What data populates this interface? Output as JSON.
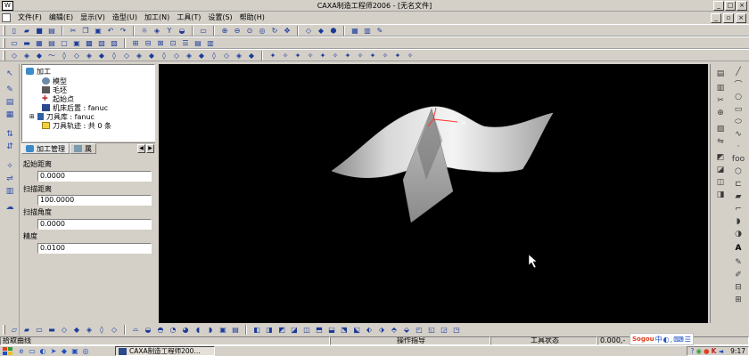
{
  "window": {
    "title": "CAXA制造工程师2006 - [无名文件]"
  },
  "menubar": {
    "items": [
      "文件(F)",
      "编辑(E)",
      "显示(V)",
      "造型(U)",
      "加工(N)",
      "工具(T)",
      "设置(S)",
      "帮助(H)"
    ]
  },
  "tree": {
    "root": "加工",
    "items": [
      "模型",
      "毛坯",
      "起始点",
      "机床后置 : fanuc",
      "刀具库 : fanuc",
      "刀具轨迹 : 共 0 条"
    ]
  },
  "panel_tabs": {
    "tab1": "加工管理",
    "tab2": "属"
  },
  "params": {
    "start_dist_label": "起始距离",
    "start_dist_value": "0.0000",
    "scan_dist_label": "扫描距离",
    "scan_dist_value": "100.0000",
    "scan_angle_label": "扫描角度",
    "scan_angle_value": "0.0000",
    "precision_label": "精度",
    "precision_value": "0.0100"
  },
  "status": {
    "prompt": "拾取曲线",
    "command_hint": "操作指导",
    "tool_state": "工具状态",
    "coords": "0.000,-"
  },
  "taskbar": {
    "task_label": "CAXA制造工程师200...",
    "clock": "9:17",
    "ime_label": "Sogou"
  },
  "right_tools": {
    "text_tool": "A",
    "foo_label": "foo"
  },
  "colors": {
    "viewport_bg": "#000000",
    "surface_light": "#e8e8e8",
    "surface_dark": "#9a9a9a",
    "axis_red": "#ff3030"
  }
}
